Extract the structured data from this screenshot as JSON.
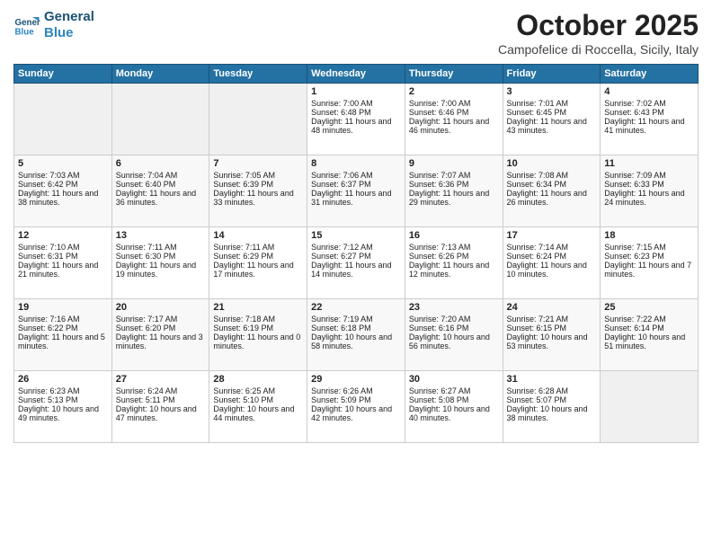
{
  "header": {
    "logo_line1": "General",
    "logo_line2": "Blue",
    "month_year": "October 2025",
    "location": "Campofelice di Roccella, Sicily, Italy"
  },
  "days_of_week": [
    "Sunday",
    "Monday",
    "Tuesday",
    "Wednesday",
    "Thursday",
    "Friday",
    "Saturday"
  ],
  "weeks": [
    [
      {
        "day": "",
        "sunrise": "",
        "sunset": "",
        "daylight": ""
      },
      {
        "day": "",
        "sunrise": "",
        "sunset": "",
        "daylight": ""
      },
      {
        "day": "",
        "sunrise": "",
        "sunset": "",
        "daylight": ""
      },
      {
        "day": "1",
        "sunrise": "Sunrise: 7:00 AM",
        "sunset": "Sunset: 6:48 PM",
        "daylight": "Daylight: 11 hours and 48 minutes."
      },
      {
        "day": "2",
        "sunrise": "Sunrise: 7:00 AM",
        "sunset": "Sunset: 6:46 PM",
        "daylight": "Daylight: 11 hours and 46 minutes."
      },
      {
        "day": "3",
        "sunrise": "Sunrise: 7:01 AM",
        "sunset": "Sunset: 6:45 PM",
        "daylight": "Daylight: 11 hours and 43 minutes."
      },
      {
        "day": "4",
        "sunrise": "Sunrise: 7:02 AM",
        "sunset": "Sunset: 6:43 PM",
        "daylight": "Daylight: 11 hours and 41 minutes."
      }
    ],
    [
      {
        "day": "5",
        "sunrise": "Sunrise: 7:03 AM",
        "sunset": "Sunset: 6:42 PM",
        "daylight": "Daylight: 11 hours and 38 minutes."
      },
      {
        "day": "6",
        "sunrise": "Sunrise: 7:04 AM",
        "sunset": "Sunset: 6:40 PM",
        "daylight": "Daylight: 11 hours and 36 minutes."
      },
      {
        "day": "7",
        "sunrise": "Sunrise: 7:05 AM",
        "sunset": "Sunset: 6:39 PM",
        "daylight": "Daylight: 11 hours and 33 minutes."
      },
      {
        "day": "8",
        "sunrise": "Sunrise: 7:06 AM",
        "sunset": "Sunset: 6:37 PM",
        "daylight": "Daylight: 11 hours and 31 minutes."
      },
      {
        "day": "9",
        "sunrise": "Sunrise: 7:07 AM",
        "sunset": "Sunset: 6:36 PM",
        "daylight": "Daylight: 11 hours and 29 minutes."
      },
      {
        "day": "10",
        "sunrise": "Sunrise: 7:08 AM",
        "sunset": "Sunset: 6:34 PM",
        "daylight": "Daylight: 11 hours and 26 minutes."
      },
      {
        "day": "11",
        "sunrise": "Sunrise: 7:09 AM",
        "sunset": "Sunset: 6:33 PM",
        "daylight": "Daylight: 11 hours and 24 minutes."
      }
    ],
    [
      {
        "day": "12",
        "sunrise": "Sunrise: 7:10 AM",
        "sunset": "Sunset: 6:31 PM",
        "daylight": "Daylight: 11 hours and 21 minutes."
      },
      {
        "day": "13",
        "sunrise": "Sunrise: 7:11 AM",
        "sunset": "Sunset: 6:30 PM",
        "daylight": "Daylight: 11 hours and 19 minutes."
      },
      {
        "day": "14",
        "sunrise": "Sunrise: 7:11 AM",
        "sunset": "Sunset: 6:29 PM",
        "daylight": "Daylight: 11 hours and 17 minutes."
      },
      {
        "day": "15",
        "sunrise": "Sunrise: 7:12 AM",
        "sunset": "Sunset: 6:27 PM",
        "daylight": "Daylight: 11 hours and 14 minutes."
      },
      {
        "day": "16",
        "sunrise": "Sunrise: 7:13 AM",
        "sunset": "Sunset: 6:26 PM",
        "daylight": "Daylight: 11 hours and 12 minutes."
      },
      {
        "day": "17",
        "sunrise": "Sunrise: 7:14 AM",
        "sunset": "Sunset: 6:24 PM",
        "daylight": "Daylight: 11 hours and 10 minutes."
      },
      {
        "day": "18",
        "sunrise": "Sunrise: 7:15 AM",
        "sunset": "Sunset: 6:23 PM",
        "daylight": "Daylight: 11 hours and 7 minutes."
      }
    ],
    [
      {
        "day": "19",
        "sunrise": "Sunrise: 7:16 AM",
        "sunset": "Sunset: 6:22 PM",
        "daylight": "Daylight: 11 hours and 5 minutes."
      },
      {
        "day": "20",
        "sunrise": "Sunrise: 7:17 AM",
        "sunset": "Sunset: 6:20 PM",
        "daylight": "Daylight: 11 hours and 3 minutes."
      },
      {
        "day": "21",
        "sunrise": "Sunrise: 7:18 AM",
        "sunset": "Sunset: 6:19 PM",
        "daylight": "Daylight: 11 hours and 0 minutes."
      },
      {
        "day": "22",
        "sunrise": "Sunrise: 7:19 AM",
        "sunset": "Sunset: 6:18 PM",
        "daylight": "Daylight: 10 hours and 58 minutes."
      },
      {
        "day": "23",
        "sunrise": "Sunrise: 7:20 AM",
        "sunset": "Sunset: 6:16 PM",
        "daylight": "Daylight: 10 hours and 56 minutes."
      },
      {
        "day": "24",
        "sunrise": "Sunrise: 7:21 AM",
        "sunset": "Sunset: 6:15 PM",
        "daylight": "Daylight: 10 hours and 53 minutes."
      },
      {
        "day": "25",
        "sunrise": "Sunrise: 7:22 AM",
        "sunset": "Sunset: 6:14 PM",
        "daylight": "Daylight: 10 hours and 51 minutes."
      }
    ],
    [
      {
        "day": "26",
        "sunrise": "Sunrise: 6:23 AM",
        "sunset": "Sunset: 5:13 PM",
        "daylight": "Daylight: 10 hours and 49 minutes."
      },
      {
        "day": "27",
        "sunrise": "Sunrise: 6:24 AM",
        "sunset": "Sunset: 5:11 PM",
        "daylight": "Daylight: 10 hours and 47 minutes."
      },
      {
        "day": "28",
        "sunrise": "Sunrise: 6:25 AM",
        "sunset": "Sunset: 5:10 PM",
        "daylight": "Daylight: 10 hours and 44 minutes."
      },
      {
        "day": "29",
        "sunrise": "Sunrise: 6:26 AM",
        "sunset": "Sunset: 5:09 PM",
        "daylight": "Daylight: 10 hours and 42 minutes."
      },
      {
        "day": "30",
        "sunrise": "Sunrise: 6:27 AM",
        "sunset": "Sunset: 5:08 PM",
        "daylight": "Daylight: 10 hours and 40 minutes."
      },
      {
        "day": "31",
        "sunrise": "Sunrise: 6:28 AM",
        "sunset": "Sunset: 5:07 PM",
        "daylight": "Daylight: 10 hours and 38 minutes."
      },
      {
        "day": "",
        "sunrise": "",
        "sunset": "",
        "daylight": ""
      }
    ]
  ]
}
